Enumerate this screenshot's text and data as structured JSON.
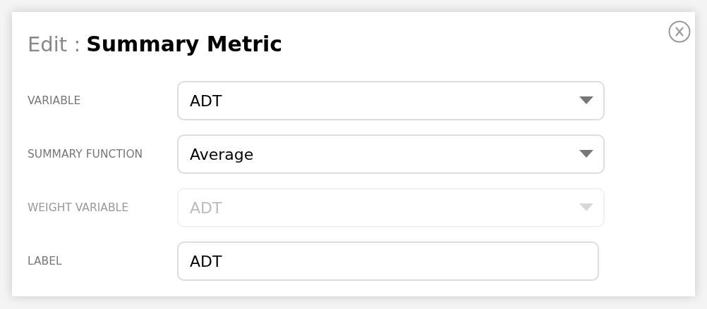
{
  "dialog": {
    "title_prefix": "Edit :",
    "title": "Summary Metric"
  },
  "fields": [
    {
      "label": "VARIABLE",
      "kind": "select",
      "value": "ADT",
      "disabled": false
    },
    {
      "label": "SUMMARY FUNCTION",
      "kind": "select",
      "value": "Average",
      "disabled": false
    },
    {
      "label": "WEIGHT VARIABLE",
      "kind": "select",
      "value": "ADT",
      "disabled": true
    },
    {
      "label": "LABEL",
      "kind": "text",
      "value": "ADT",
      "disabled": false
    }
  ]
}
